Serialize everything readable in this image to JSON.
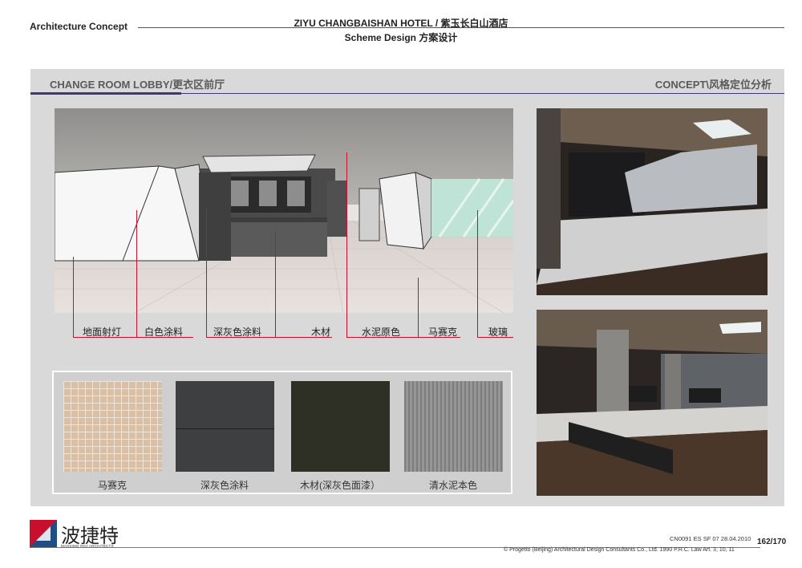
{
  "header": {
    "section": "Architecture Concept",
    "title": "ZIYU CHANGBAISHAN HOTEL / 紫玉长白山酒店",
    "subtitle": "Scheme Design 方案设计"
  },
  "page": {
    "left_heading": "CHANGE ROOM LOBBY/更衣区前厅",
    "right_heading": "CONCEPT\\风格定位分析"
  },
  "callouts": [
    "地面射灯",
    "白色涂料",
    "深灰色涂料",
    "木材",
    "水泥原色",
    "马赛克",
    "玻璃"
  ],
  "materials": [
    "马赛克",
    "深灰色涂料",
    "木材(深灰色面漆）",
    "清水泥本色"
  ],
  "footer": {
    "logo_text": "波捷特",
    "logo_sub": "MASSIMO ROJ ARCHITECTS",
    "code": "CN0091 ES SF 07  28.04.2010",
    "page": "162/170",
    "copyright": "© Progetto (Beijing) Architectural Design Consultants Co., Ltd. 1990 P.R.C. Law  Art. 3, 10, 11"
  },
  "colors": {
    "accent": "#c8102e",
    "heading_bar": "#3a3a7a",
    "panel": "#d9d9d9"
  }
}
